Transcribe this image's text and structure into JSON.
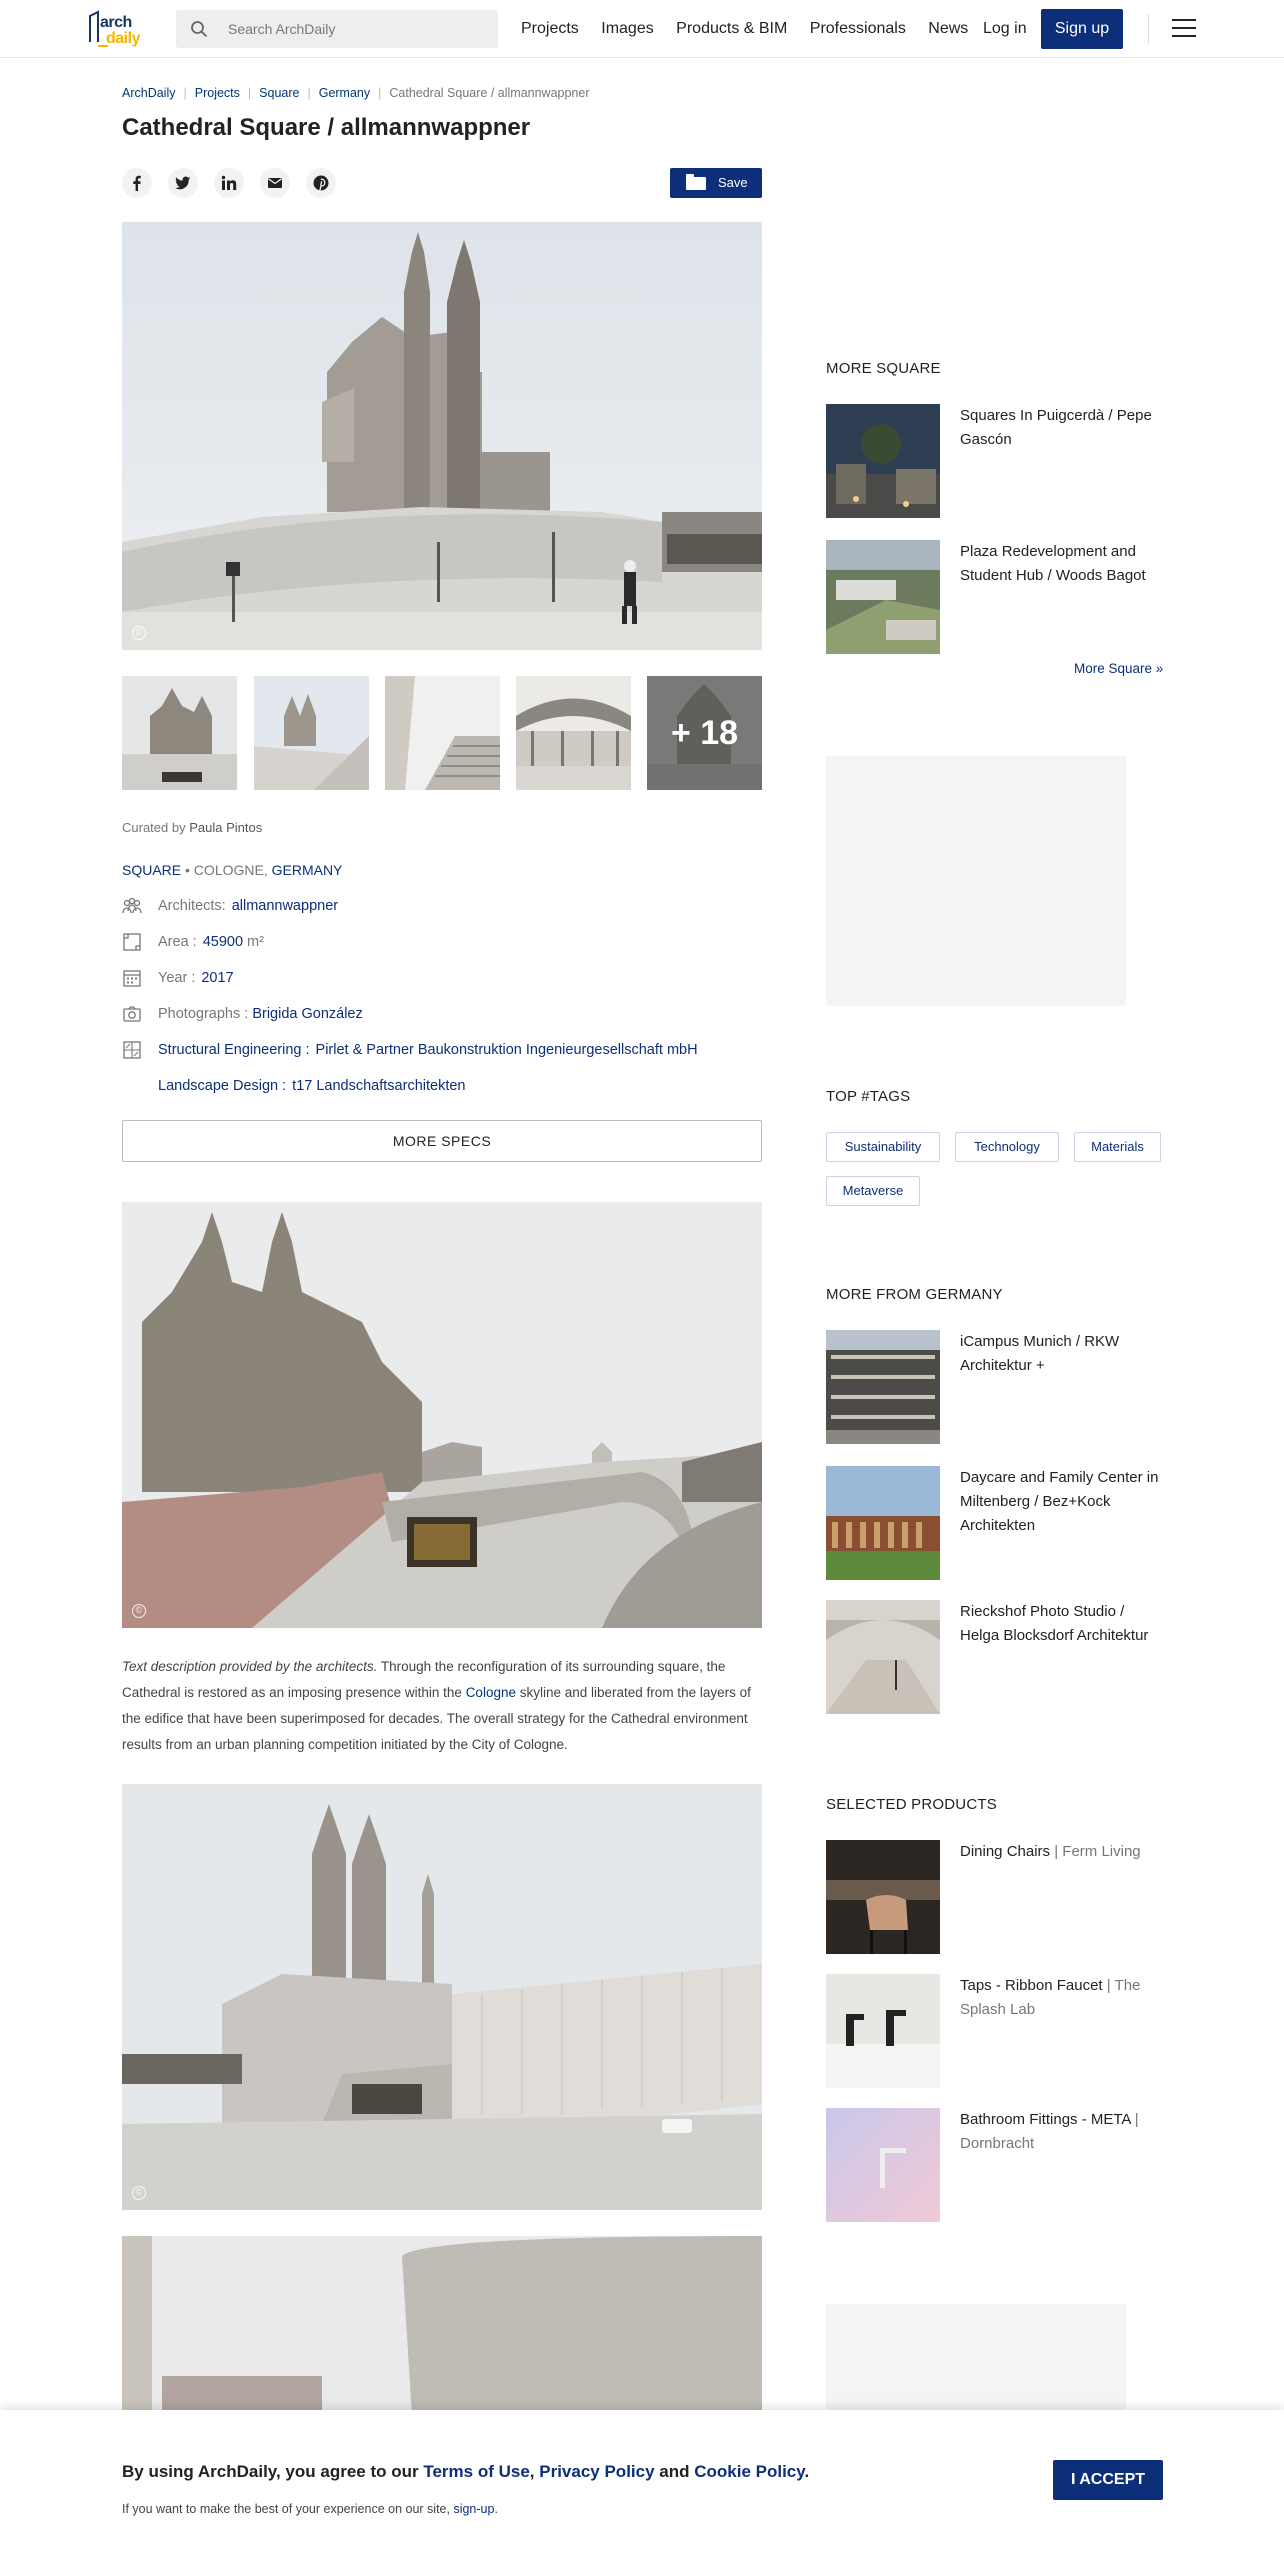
{
  "header": {
    "logo_top": "arch",
    "logo_bottom": "daily",
    "search_placeholder": "Search ArchDaily",
    "nav": [
      "Projects",
      "Images",
      "Products & BIM",
      "Professionals",
      "News"
    ],
    "login": "Log in",
    "signup": "Sign up"
  },
  "breadcrumb": [
    "ArchDaily",
    "Projects",
    "Square",
    "Germany"
  ],
  "breadcrumb_current": "Cathedral Square / allmannwappner",
  "title": "Cathedral Square / allmannwappner",
  "save_label": "Save",
  "social_icons": [
    "facebook-icon",
    "twitter-icon",
    "linkedin-icon",
    "email-icon",
    "pinterest-icon"
  ],
  "gallery_more": "+ 18",
  "curated": {
    "prefix": "Curated by",
    "name": "Paula Pintos"
  },
  "category": {
    "type": "SQUARE",
    "city": "COLOGNE",
    "country": "GERMANY"
  },
  "specs": {
    "architects_label": "Architects:",
    "architects_value": "allmannwappner",
    "area_label": "Area :",
    "area_value": "45900",
    "area_unit": "m²",
    "year_label": "Year :",
    "year_value": "2017",
    "photos_label": "Photographs :",
    "photos_value": "Brigida González",
    "struct_label": "Structural Engineering :",
    "struct_value": "Pirlet & Partner Baukonstruktion Ingenieurgesellschaft mbH",
    "landscape_label": "Landscape Design :",
    "landscape_value": "t17 Landschaftsarchitekten"
  },
  "more_specs": "MORE SPECS",
  "description": {
    "intro": "Text description provided by the architects.",
    "part1": " Through the reconfiguration of its surrounding square, the Cathedral is restored as an imposing presence within the ",
    "link": "Cologne",
    "part2": " skyline and liberated from the layers of the edifice that have been superimposed for decades. The overall strategy for the Cathedral environment results from an urban planning competition initiated by the City of Cologne."
  },
  "sidebar": {
    "more_square_title": "MORE SQUARE",
    "more_square": [
      {
        "title": "Squares In Puigcerdà / Pepe Gascón"
      },
      {
        "title": "Plaza Redevelopment and Student Hub / Woods Bagot"
      }
    ],
    "more_square_link": "More Square »",
    "tags_title": "TOP #TAGS",
    "tags": [
      "Sustainability",
      "Technology",
      "Materials",
      "Metaverse"
    ],
    "more_germany_title": "MORE FROM GERMANY",
    "more_germany": [
      {
        "title": "iCampus Munich / RKW Architektur +"
      },
      {
        "title": "Daycare and Family Center in Miltenberg / Bez+Kock Architekten"
      },
      {
        "title": "Rieckshof Photo Studio / Helga Blocksdorf Architektur"
      }
    ],
    "products_title": "SELECTED PRODUCTS",
    "products": [
      {
        "name": "Dining Chairs",
        "brand": "| Ferm Living"
      },
      {
        "name": "Taps - Ribbon Faucet",
        "brand": "| The Splash Lab"
      },
      {
        "name": "Bathroom Fittings - META",
        "brand": "| Dornbracht"
      }
    ]
  },
  "cookie": {
    "line1_a": "By using ArchDaily, you agree to our ",
    "terms": "Terms of Use",
    "comma": ", ",
    "privacy": "Privacy Policy",
    "and": " and ",
    "cookie_policy": "Cookie Policy",
    "dot": ".",
    "line2_a": "If you want to make the best of your experience on our site, ",
    "signup": "sign-up",
    "line2_b": ".",
    "accept": "I ACCEPT"
  }
}
